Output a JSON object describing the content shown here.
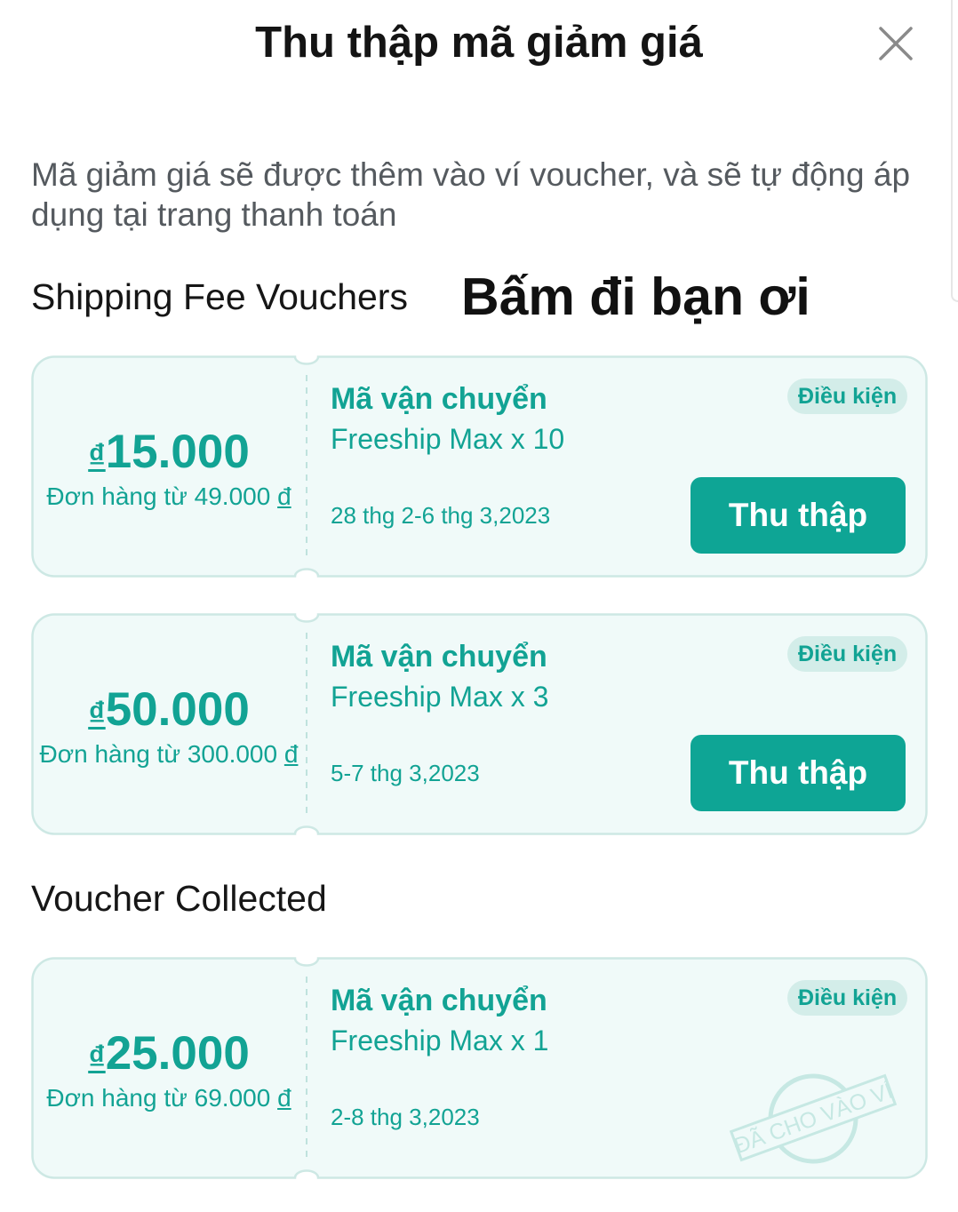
{
  "header": {
    "title": "Thu thập mã giảm giá",
    "close_icon": "close-icon"
  },
  "description": "Mã giảm giá sẽ được thêm vào ví voucher, và sẽ tự động áp dụng tại trang thanh toán",
  "sections": {
    "shipping_title": "Shipping Fee Vouchers",
    "collected_title": "Voucher Collected"
  },
  "overlay_text": "Bấm đi bạn ơi",
  "currency_symbol": "₫",
  "vouchers": [
    {
      "amount": "15.000",
      "min_order": "Đơn hàng từ 49.000",
      "type": "Mã vận chuyển",
      "name": "Freeship Max x 10",
      "date": "28 thg 2-6 thg 3,2023",
      "condition_label": "Điều kiện",
      "button_label": "Thu thập"
    },
    {
      "amount": "50.000",
      "min_order": "Đơn hàng từ 300.000",
      "type": "Mã vận chuyển",
      "name": "Freeship Max x 3",
      "date": "5-7 thg 3,2023",
      "condition_label": "Điều kiện",
      "button_label": "Thu thập"
    }
  ],
  "collected": [
    {
      "amount": "25.000",
      "min_order": "Đơn hàng từ 69.000",
      "type": "Mã vận chuyển",
      "name": "Freeship Max x 1",
      "date": "2-8 thg 3,2023",
      "condition_label": "Điều kiện",
      "stamp_text": "ĐÃ CHO VÀO VÍ"
    }
  ],
  "colors": {
    "accent": "#0ea595",
    "card_bg": "#f0faf9",
    "card_border": "#cde8e4",
    "badge_bg": "#d3ede9"
  }
}
